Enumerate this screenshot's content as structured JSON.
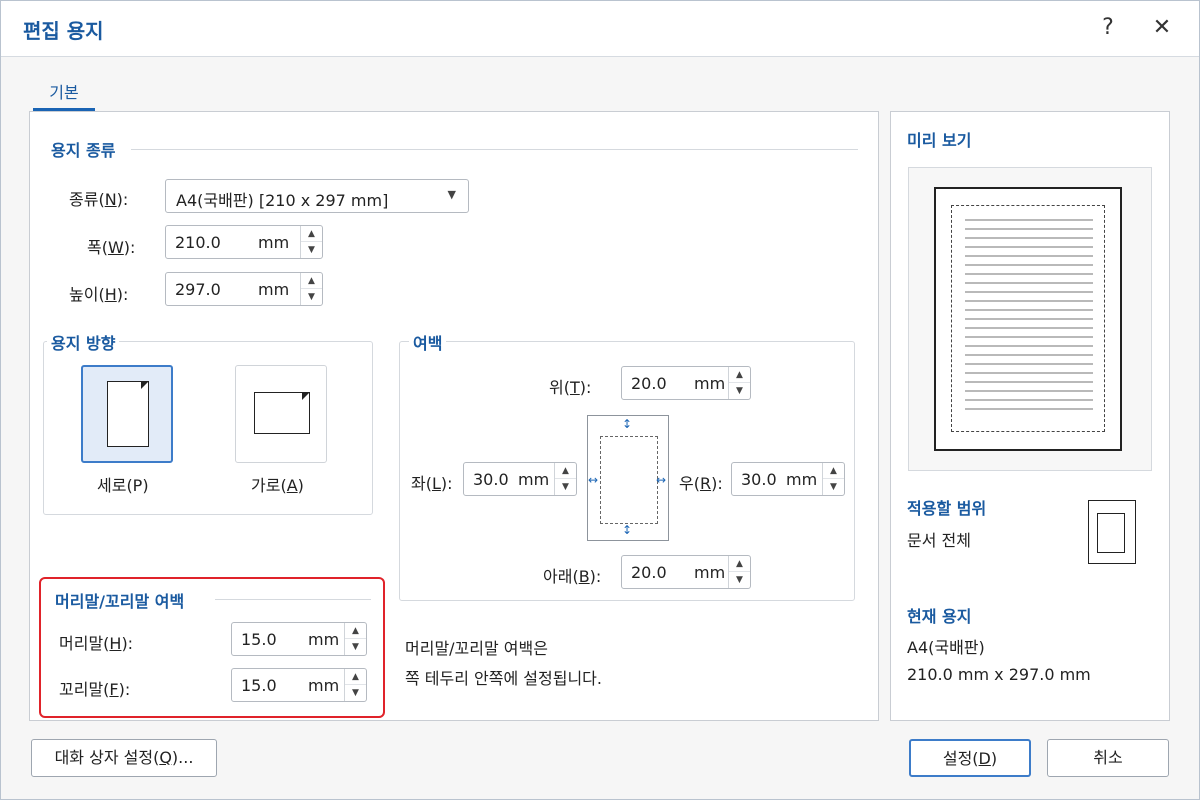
{
  "dialog": {
    "title": "편집 용지",
    "help_label": "?",
    "close_label": "✕"
  },
  "tabs": [
    {
      "label": "기본"
    }
  ],
  "paper_type": {
    "group_title": "용지 종류",
    "type_label_pre": "종류(",
    "type_label_key": "N",
    "type_label_post": "):",
    "type_value": "A4(국배판)  [210 x 297 mm]",
    "width_label_pre": "폭(",
    "width_label_key": "W",
    "width_label_post": "):",
    "width_value": "210.0",
    "width_unit": "mm",
    "height_label_pre": "높이(",
    "height_label_key": "H",
    "height_label_post": "):",
    "height_value": "297.0",
    "height_unit": "mm"
  },
  "orientation": {
    "group_title": "용지 방향",
    "portrait_label": "세로(P)",
    "landscape_label_pre": "가로(",
    "landscape_label_key": "A",
    "landscape_label_post": ")",
    "selected": "portrait"
  },
  "margins": {
    "group_title": "여백",
    "top_label_pre": "위(",
    "top_label_key": "T",
    "top_label_post": "):",
    "top_value": "20.0",
    "left_label_pre": "좌(",
    "left_label_key": "L",
    "left_label_post": "):",
    "left_value": "30.0",
    "right_label_pre": "우(",
    "right_label_key": "R",
    "right_label_post": "):",
    "right_value": "30.0",
    "bottom_label_pre": "아래(",
    "bottom_label_key": "B",
    "bottom_label_post": "):",
    "bottom_value": "20.0",
    "unit": "mm"
  },
  "header_footer": {
    "group_title": "머리말/꼬리말 여백",
    "header_label_pre": "머리말(",
    "header_label_key": "H",
    "header_label_post": "):",
    "header_value": "15.0",
    "footer_label_pre": "꼬리말(",
    "footer_label_key": "F",
    "footer_label_post": "):",
    "footer_value": "15.0",
    "unit": "mm",
    "description_line1": "머리말/꼬리말 여백은",
    "description_line2": "쪽 테두리 안쪽에 설정됩니다."
  },
  "preview": {
    "title": "미리 보기",
    "scope_title": "적용할 범위",
    "scope_value": "문서 전체",
    "current_title": "현재 용지",
    "current_name": "A4(국배판)",
    "current_size": "210.0 mm x 297.0 mm"
  },
  "footer_buttons": {
    "dialog_settings_pre": "대화 상자 설정(",
    "dialog_settings_key": "Q",
    "dialog_settings_post": ")...",
    "ok_pre": "설정(",
    "ok_key": "D",
    "ok_post": ")",
    "cancel": "취소"
  },
  "colors": {
    "accent": "#1a5aa0",
    "highlight_border": "#e0232a",
    "selected_bg": "#e2ebf8"
  }
}
